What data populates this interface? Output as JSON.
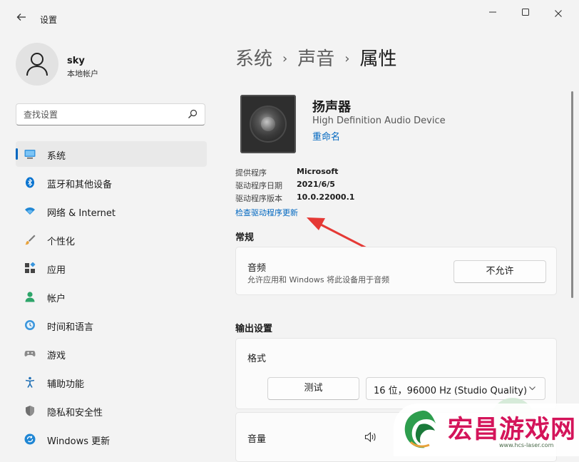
{
  "window": {
    "title": "设置",
    "back_icon": "back-arrow-icon",
    "minimize_icon": "minimize-icon",
    "maximize_icon": "maximize-icon",
    "close_icon": "close-icon"
  },
  "profile": {
    "name": "sky",
    "type": "本地帐户"
  },
  "search": {
    "placeholder": "查找设置"
  },
  "sidebar": {
    "items": [
      {
        "label": "系统",
        "icon": "system-icon",
        "active": true
      },
      {
        "label": "蓝牙和其他设备",
        "icon": "bluetooth-icon"
      },
      {
        "label": "网络 & Internet",
        "icon": "network-icon"
      },
      {
        "label": "个性化",
        "icon": "personalization-icon"
      },
      {
        "label": "应用",
        "icon": "apps-icon"
      },
      {
        "label": "帐户",
        "icon": "accounts-icon"
      },
      {
        "label": "时间和语言",
        "icon": "time-language-icon"
      },
      {
        "label": "游戏",
        "icon": "gaming-icon"
      },
      {
        "label": "辅助功能",
        "icon": "accessibility-icon"
      },
      {
        "label": "隐私和安全性",
        "icon": "privacy-icon"
      },
      {
        "label": "Windows 更新",
        "icon": "windows-update-icon"
      }
    ]
  },
  "breadcrumb": {
    "part1": "系统",
    "part2": "声音",
    "current": "属性",
    "separator": "›"
  },
  "device": {
    "name": "扬声器",
    "description": "High Definition Audio Device",
    "rename_label": "重命名",
    "icon": "speaker-icon"
  },
  "driver": {
    "rows": [
      {
        "label": "提供程序",
        "value": "Microsoft"
      },
      {
        "label": "驱动程序日期",
        "value": "2021/6/5"
      },
      {
        "label": "驱动程序版本",
        "value": "10.0.22000.1"
      }
    ],
    "update_link": "检查驱动程序更新"
  },
  "general": {
    "title": "常规",
    "audio_title": "音频",
    "audio_desc": "允许应用和 Windows 将此设备用于音频",
    "audio_button": "不允许"
  },
  "output": {
    "title": "输出设置",
    "format_title": "格式",
    "test_button": "测试",
    "format_value": "16 位，96000 Hz (Studio Quality)",
    "volume_title": "音量",
    "volume_icon": "volume-icon"
  },
  "watermark": {
    "text": "宏昌游戏网",
    "url": "www.hcs-laser.com"
  },
  "colors": {
    "accent": "#0067c0",
    "annotation": "#e53935",
    "watermark": "#d4145a"
  }
}
